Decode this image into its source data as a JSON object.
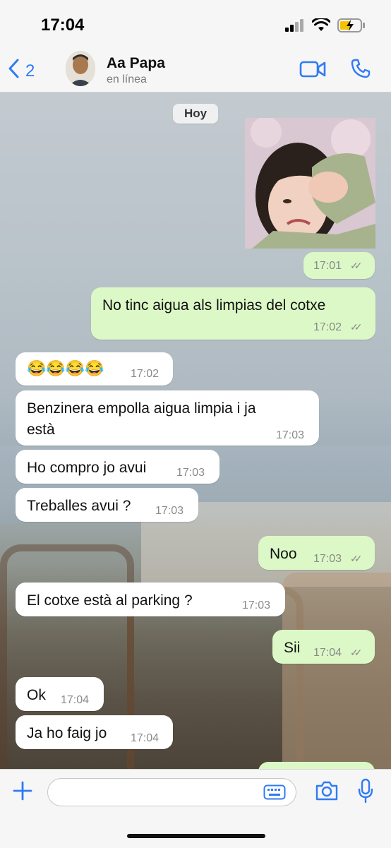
{
  "status_bar": {
    "time": "17:04"
  },
  "header": {
    "back_count": "2",
    "contact_name": "Aa Papa",
    "contact_status": "en línea"
  },
  "chat": {
    "date_label": "Hoy",
    "photo_message": {
      "time": "17:01",
      "ticks": "✓✓"
    },
    "messages": [
      {
        "direction": "out",
        "text": "No tinc aigua als limpias del cotxe",
        "time": "17:02",
        "ticks": "✓✓"
      },
      {
        "direction": "in",
        "text": "😂😂😂😂",
        "time": "17:02"
      },
      {
        "direction": "in",
        "text": "Benzinera empolla aigua limpia i ja",
        "text_line2": "està",
        "time": "17:03"
      },
      {
        "direction": "in",
        "text": "Ho compro jo avui",
        "time": "17:03"
      },
      {
        "direction": "in",
        "text": "Treballes avui ?",
        "time": "17:03"
      },
      {
        "direction": "out",
        "text": "Noo",
        "time": "17:03",
        "ticks": "✓✓"
      },
      {
        "direction": "in",
        "text": "El cotxe està al parking ?",
        "time": "17:03"
      },
      {
        "direction": "out",
        "text": "Sii",
        "time": "17:04",
        "ticks": "✓✓"
      },
      {
        "direction": "in",
        "text": "Ok",
        "time": "17:04"
      },
      {
        "direction": "in",
        "text": "Ja ho faig jo",
        "time": "17:04"
      }
    ]
  },
  "composer": {
    "placeholder": ""
  },
  "icons": {
    "back": "chevron-left-icon",
    "video": "video-camera-icon",
    "call": "phone-icon",
    "plus": "plus-icon",
    "sticker": "keyboard-sticker-icon",
    "camera": "camera-icon",
    "mic": "microphone-icon"
  },
  "colors": {
    "accent": "#2f7bf5",
    "outgoing_bubble": "#dcf8c6",
    "incoming_bubble": "#ffffff",
    "read_ticks": "#8a8a8a"
  }
}
